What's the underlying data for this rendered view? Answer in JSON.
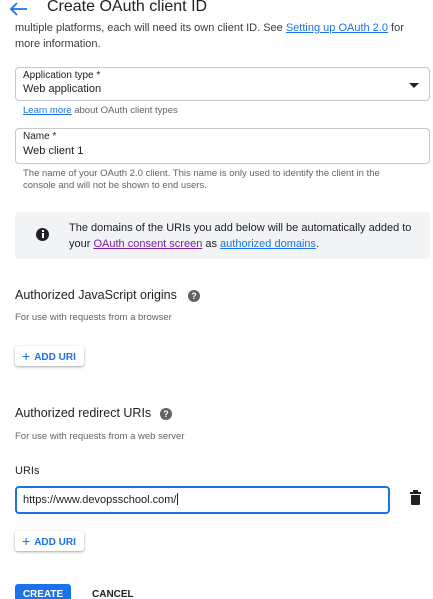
{
  "header": {
    "title": "Create OAuth client ID"
  },
  "intro": {
    "before_link": "multiple platforms, each will need its own client ID. See ",
    "link": "Setting up OAuth 2.0",
    "after_link": " for more information."
  },
  "application_type": {
    "label": "Application type *",
    "value": "Web application",
    "learn_link": "Learn more",
    "learn_rest": " about OAuth client types"
  },
  "name_field": {
    "label": "Name *",
    "value": "Web client 1",
    "helper": "The name of your OAuth 2.0 client. This name is only used to identify the client in the console and will not be shown to end users."
  },
  "banner": {
    "text_1": "The domains of the URIs you add below will be automatically added to your ",
    "link_1": "OAuth consent screen",
    "text_2": " as ",
    "link_2": "authorized domains",
    "text_3": "."
  },
  "js_origins": {
    "title": "Authorized JavaScript origins",
    "help": "?",
    "desc": "For use with requests from a browser",
    "add_label": "ADD URI"
  },
  "redirect_uris": {
    "title": "Authorized redirect URIs",
    "help": "?",
    "desc": "For use with requests from a web server",
    "uris_label": "URIs",
    "uri_value": "https://www.devopsschool.com/",
    "add_label": "ADD URI"
  },
  "actions": {
    "create": "CREATE",
    "cancel": "CANCEL"
  },
  "icons": {
    "back": "arrow-back-icon",
    "dropdown": "caret-down-icon",
    "info": "info-icon",
    "help": "help-icon",
    "add": "plus-icon",
    "delete": "trash-icon"
  },
  "colors": {
    "accent": "#1a73e8",
    "visited_link": "#7b1fa2",
    "banner_bg": "#f1f3f4"
  }
}
